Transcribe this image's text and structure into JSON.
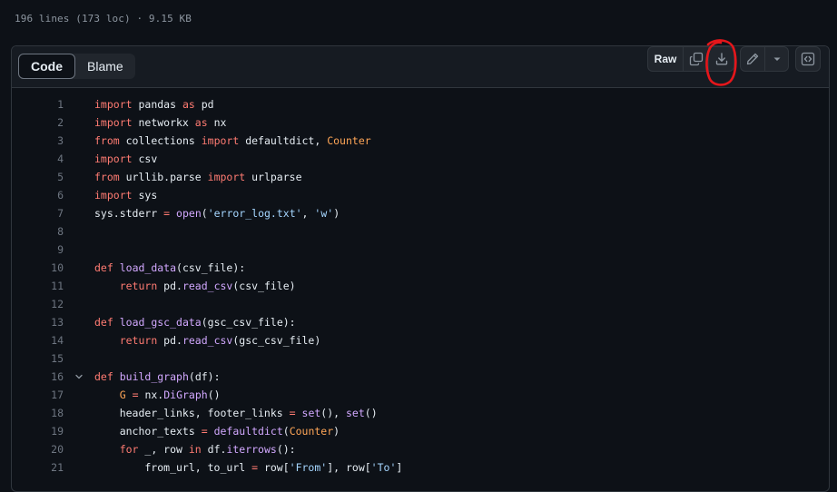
{
  "file_meta": "196 lines (173 loc) · 9.15 KB",
  "tabs": [
    {
      "label": "Code",
      "active": true
    },
    {
      "label": "Blame",
      "active": false
    }
  ],
  "actions": {
    "raw_label": "Raw",
    "copy_icon": "copy-icon",
    "download_icon": "download-icon",
    "edit_icon": "pencil-icon",
    "more_icon": "triangle-down-icon",
    "symbols_icon": "code-square-icon"
  },
  "annotation_color": "#e5161b",
  "code": [
    {
      "n": "1",
      "tokens": [
        [
          "kw",
          "import"
        ],
        [
          "t",
          " pandas "
        ],
        [
          "kw",
          "as"
        ],
        [
          "t",
          " pd"
        ]
      ]
    },
    {
      "n": "2",
      "tokens": [
        [
          "kw",
          "import"
        ],
        [
          "t",
          " networkx "
        ],
        [
          "kw",
          "as"
        ],
        [
          "t",
          " nx"
        ]
      ]
    },
    {
      "n": "3",
      "tokens": [
        [
          "kw",
          "from"
        ],
        [
          "t",
          " collections "
        ],
        [
          "kw",
          "import"
        ],
        [
          "t",
          " defaultdict, "
        ],
        [
          "bi",
          "Counter"
        ]
      ]
    },
    {
      "n": "4",
      "tokens": [
        [
          "kw",
          "import"
        ],
        [
          "t",
          " csv"
        ]
      ]
    },
    {
      "n": "5",
      "tokens": [
        [
          "kw",
          "from"
        ],
        [
          "t",
          " urllib.parse "
        ],
        [
          "kw",
          "import"
        ],
        [
          "t",
          " urlparse"
        ]
      ]
    },
    {
      "n": "6",
      "tokens": [
        [
          "kw",
          "import"
        ],
        [
          "t",
          " sys"
        ]
      ]
    },
    {
      "n": "7",
      "tokens": [
        [
          "t",
          "sys.stderr "
        ],
        [
          "kw",
          "="
        ],
        [
          "t",
          " "
        ],
        [
          "fn",
          "open"
        ],
        [
          "t",
          "("
        ],
        [
          "st",
          "'error_log.txt'"
        ],
        [
          "t",
          ", "
        ],
        [
          "st",
          "'w'"
        ],
        [
          "t",
          ")"
        ]
      ]
    },
    {
      "n": "8",
      "tokens": []
    },
    {
      "n": "9",
      "tokens": []
    },
    {
      "n": "10",
      "tokens": [
        [
          "kw",
          "def"
        ],
        [
          "t",
          " "
        ],
        [
          "fn",
          "load_data"
        ],
        [
          "t",
          "(csv_file):"
        ]
      ]
    },
    {
      "n": "11",
      "tokens": [
        [
          "t",
          "    "
        ],
        [
          "kw",
          "return"
        ],
        [
          "t",
          " pd."
        ],
        [
          "fn",
          "read_csv"
        ],
        [
          "t",
          "(csv_file)"
        ]
      ]
    },
    {
      "n": "12",
      "tokens": []
    },
    {
      "n": "13",
      "tokens": [
        [
          "kw",
          "def"
        ],
        [
          "t",
          " "
        ],
        [
          "fn",
          "load_gsc_data"
        ],
        [
          "t",
          "(gsc_csv_file):"
        ]
      ]
    },
    {
      "n": "14",
      "tokens": [
        [
          "t",
          "    "
        ],
        [
          "kw",
          "return"
        ],
        [
          "t",
          " pd."
        ],
        [
          "fn",
          "read_csv"
        ],
        [
          "t",
          "(gsc_csv_file)"
        ]
      ]
    },
    {
      "n": "15",
      "tokens": []
    },
    {
      "n": "16",
      "fold": true,
      "tokens": [
        [
          "kw",
          "def"
        ],
        [
          "t",
          " "
        ],
        [
          "fn",
          "build_graph"
        ],
        [
          "t",
          "(df):"
        ]
      ]
    },
    {
      "n": "17",
      "tokens": [
        [
          "t",
          "    "
        ],
        [
          "bi",
          "G"
        ],
        [
          "t",
          " "
        ],
        [
          "kw",
          "="
        ],
        [
          "t",
          " nx."
        ],
        [
          "fn",
          "DiGraph"
        ],
        [
          "t",
          "()"
        ]
      ]
    },
    {
      "n": "18",
      "tokens": [
        [
          "t",
          "    header_links, footer_links "
        ],
        [
          "kw",
          "="
        ],
        [
          "t",
          " "
        ],
        [
          "fn",
          "set"
        ],
        [
          "t",
          "(), "
        ],
        [
          "fn",
          "set"
        ],
        [
          "t",
          "()"
        ]
      ]
    },
    {
      "n": "19",
      "tokens": [
        [
          "t",
          "    anchor_texts "
        ],
        [
          "kw",
          "="
        ],
        [
          "t",
          " "
        ],
        [
          "fn",
          "defaultdict"
        ],
        [
          "t",
          "("
        ],
        [
          "bi",
          "Counter"
        ],
        [
          "t",
          ")"
        ]
      ]
    },
    {
      "n": "20",
      "tokens": [
        [
          "t",
          "    "
        ],
        [
          "kw",
          "for"
        ],
        [
          "t",
          " _, row "
        ],
        [
          "kw",
          "in"
        ],
        [
          "t",
          " df."
        ],
        [
          "fn",
          "iterrows"
        ],
        [
          "t",
          "():"
        ]
      ]
    },
    {
      "n": "21",
      "tokens": [
        [
          "t",
          "        from_url, to_url "
        ],
        [
          "kw",
          "="
        ],
        [
          "t",
          " row["
        ],
        [
          "st",
          "'From'"
        ],
        [
          "t",
          "], row["
        ],
        [
          "st",
          "'To'"
        ],
        [
          "t",
          "]"
        ]
      ]
    }
  ]
}
